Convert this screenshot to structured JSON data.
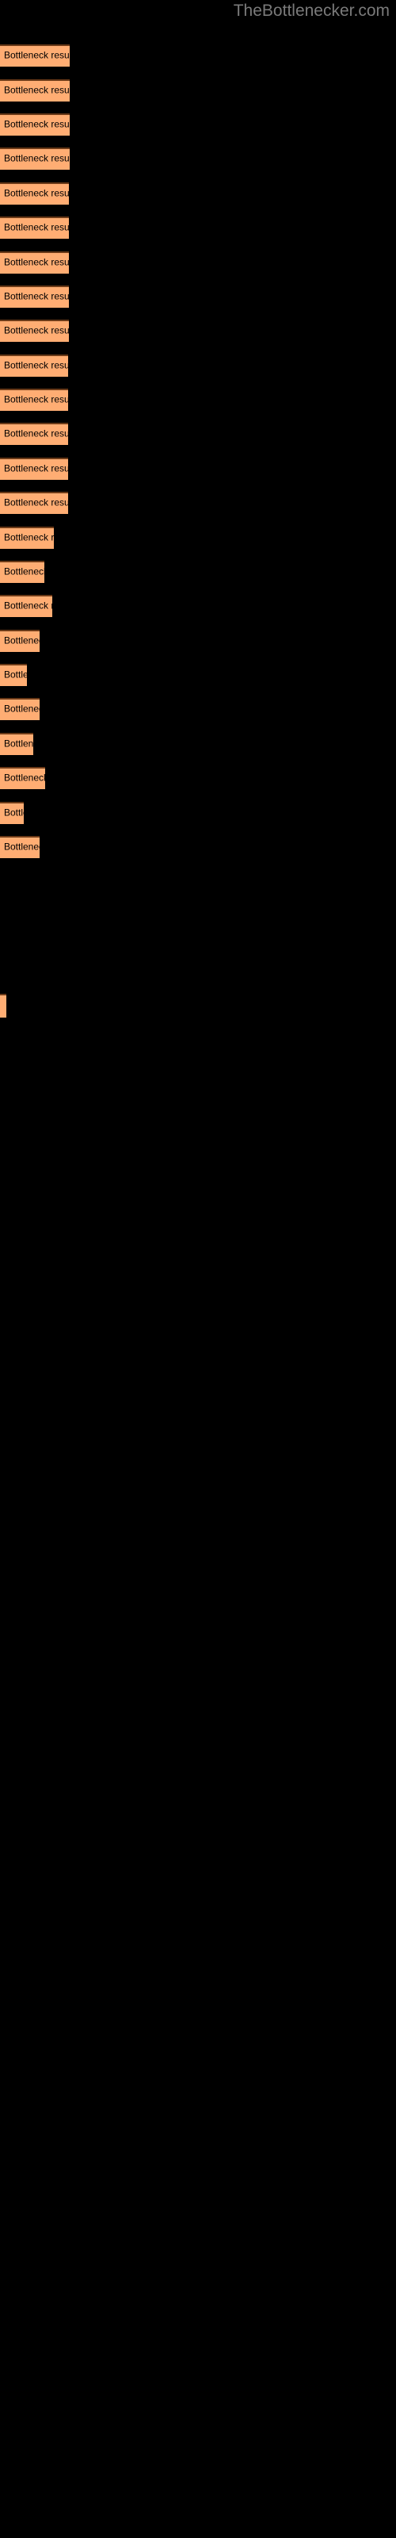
{
  "header": {
    "site_title": "TheBottlenecker.com",
    "title_color": "#7a7a7a"
  },
  "colors": {
    "background": "#000000",
    "bar_fill": "#ffad73",
    "bar_border_top": "#6b3a18",
    "label_text": "#000000"
  },
  "chart_data": {
    "type": "bar",
    "orientation": "horizontal",
    "title": "",
    "subtitle": "",
    "xlabel": "",
    "ylabel": "",
    "grid": false,
    "legend": null,
    "axis_labels_visible": false,
    "bar_label_text": "Bottleneck result",
    "categories": [
      "bar-01",
      "bar-02",
      "bar-03",
      "bar-04",
      "bar-05",
      "bar-06",
      "bar-07",
      "bar-08",
      "bar-09",
      "bar-10",
      "bar-11",
      "bar-12",
      "bar-13",
      "bar-14",
      "bar-15",
      "bar-16",
      "bar-17",
      "bar-18",
      "bar-19",
      "bar-20",
      "bar-21",
      "bar-22",
      "bar-23",
      "bar-24",
      "bar-25"
    ],
    "values": [
      88,
      88,
      88,
      88,
      87,
      87,
      87,
      87,
      87,
      86,
      86,
      86,
      86,
      86,
      68,
      56,
      66,
      50,
      34,
      50,
      42,
      57,
      30,
      50,
      8
    ],
    "xlim": [
      0,
      500
    ],
    "bars": [
      {
        "label": "Bottleneck result",
        "top": 56,
        "height": 28,
        "width": 88
      },
      {
        "label": "Bottleneck result",
        "top": 100,
        "height": 28,
        "width": 88
      },
      {
        "label": "Bottleneck result",
        "top": 143,
        "height": 28,
        "width": 88
      },
      {
        "label": "Bottleneck result",
        "top": 186,
        "height": 28,
        "width": 88
      },
      {
        "label": "Bottleneck result",
        "top": 230,
        "height": 28,
        "width": 87
      },
      {
        "label": "Bottleneck result",
        "top": 273,
        "height": 28,
        "width": 87
      },
      {
        "label": "Bottleneck result",
        "top": 317,
        "height": 28,
        "width": 87
      },
      {
        "label": "Bottleneck result",
        "top": 360,
        "height": 28,
        "width": 87
      },
      {
        "label": "Bottleneck result",
        "top": 403,
        "height": 28,
        "width": 87
      },
      {
        "label": "Bottleneck result",
        "top": 447,
        "height": 28,
        "width": 86
      },
      {
        "label": "Bottleneck result",
        "top": 490,
        "height": 28,
        "width": 86
      },
      {
        "label": "Bottleneck result",
        "top": 533,
        "height": 28,
        "width": 86
      },
      {
        "label": "Bottleneck result",
        "top": 577,
        "height": 28,
        "width": 86
      },
      {
        "label": "Bottleneck result",
        "top": 620,
        "height": 28,
        "width": 86
      },
      {
        "label": "Bottleneck result",
        "top": 664,
        "height": 28,
        "width": 68
      },
      {
        "label": "Bottleneck result",
        "top": 707,
        "height": 28,
        "width": 56
      },
      {
        "label": "Bottleneck result",
        "top": 750,
        "height": 28,
        "width": 66
      },
      {
        "label": "Bottleneck result",
        "top": 794,
        "height": 28,
        "width": 50
      },
      {
        "label": "Bottleneck result",
        "top": 837,
        "height": 28,
        "width": 34
      },
      {
        "label": "Bottleneck result",
        "top": 880,
        "height": 28,
        "width": 50
      },
      {
        "label": "Bottleneck result",
        "top": 924,
        "height": 28,
        "width": 42
      },
      {
        "label": "Bottleneck result",
        "top": 967,
        "height": 28,
        "width": 57
      },
      {
        "label": "Bottleneck result",
        "top": 1011,
        "height": 28,
        "width": 30
      },
      {
        "label": "Bottleneck result",
        "top": 1054,
        "height": 28,
        "width": 50
      },
      {
        "label": "",
        "top": 1253,
        "height": 30,
        "width": 8
      }
    ]
  }
}
